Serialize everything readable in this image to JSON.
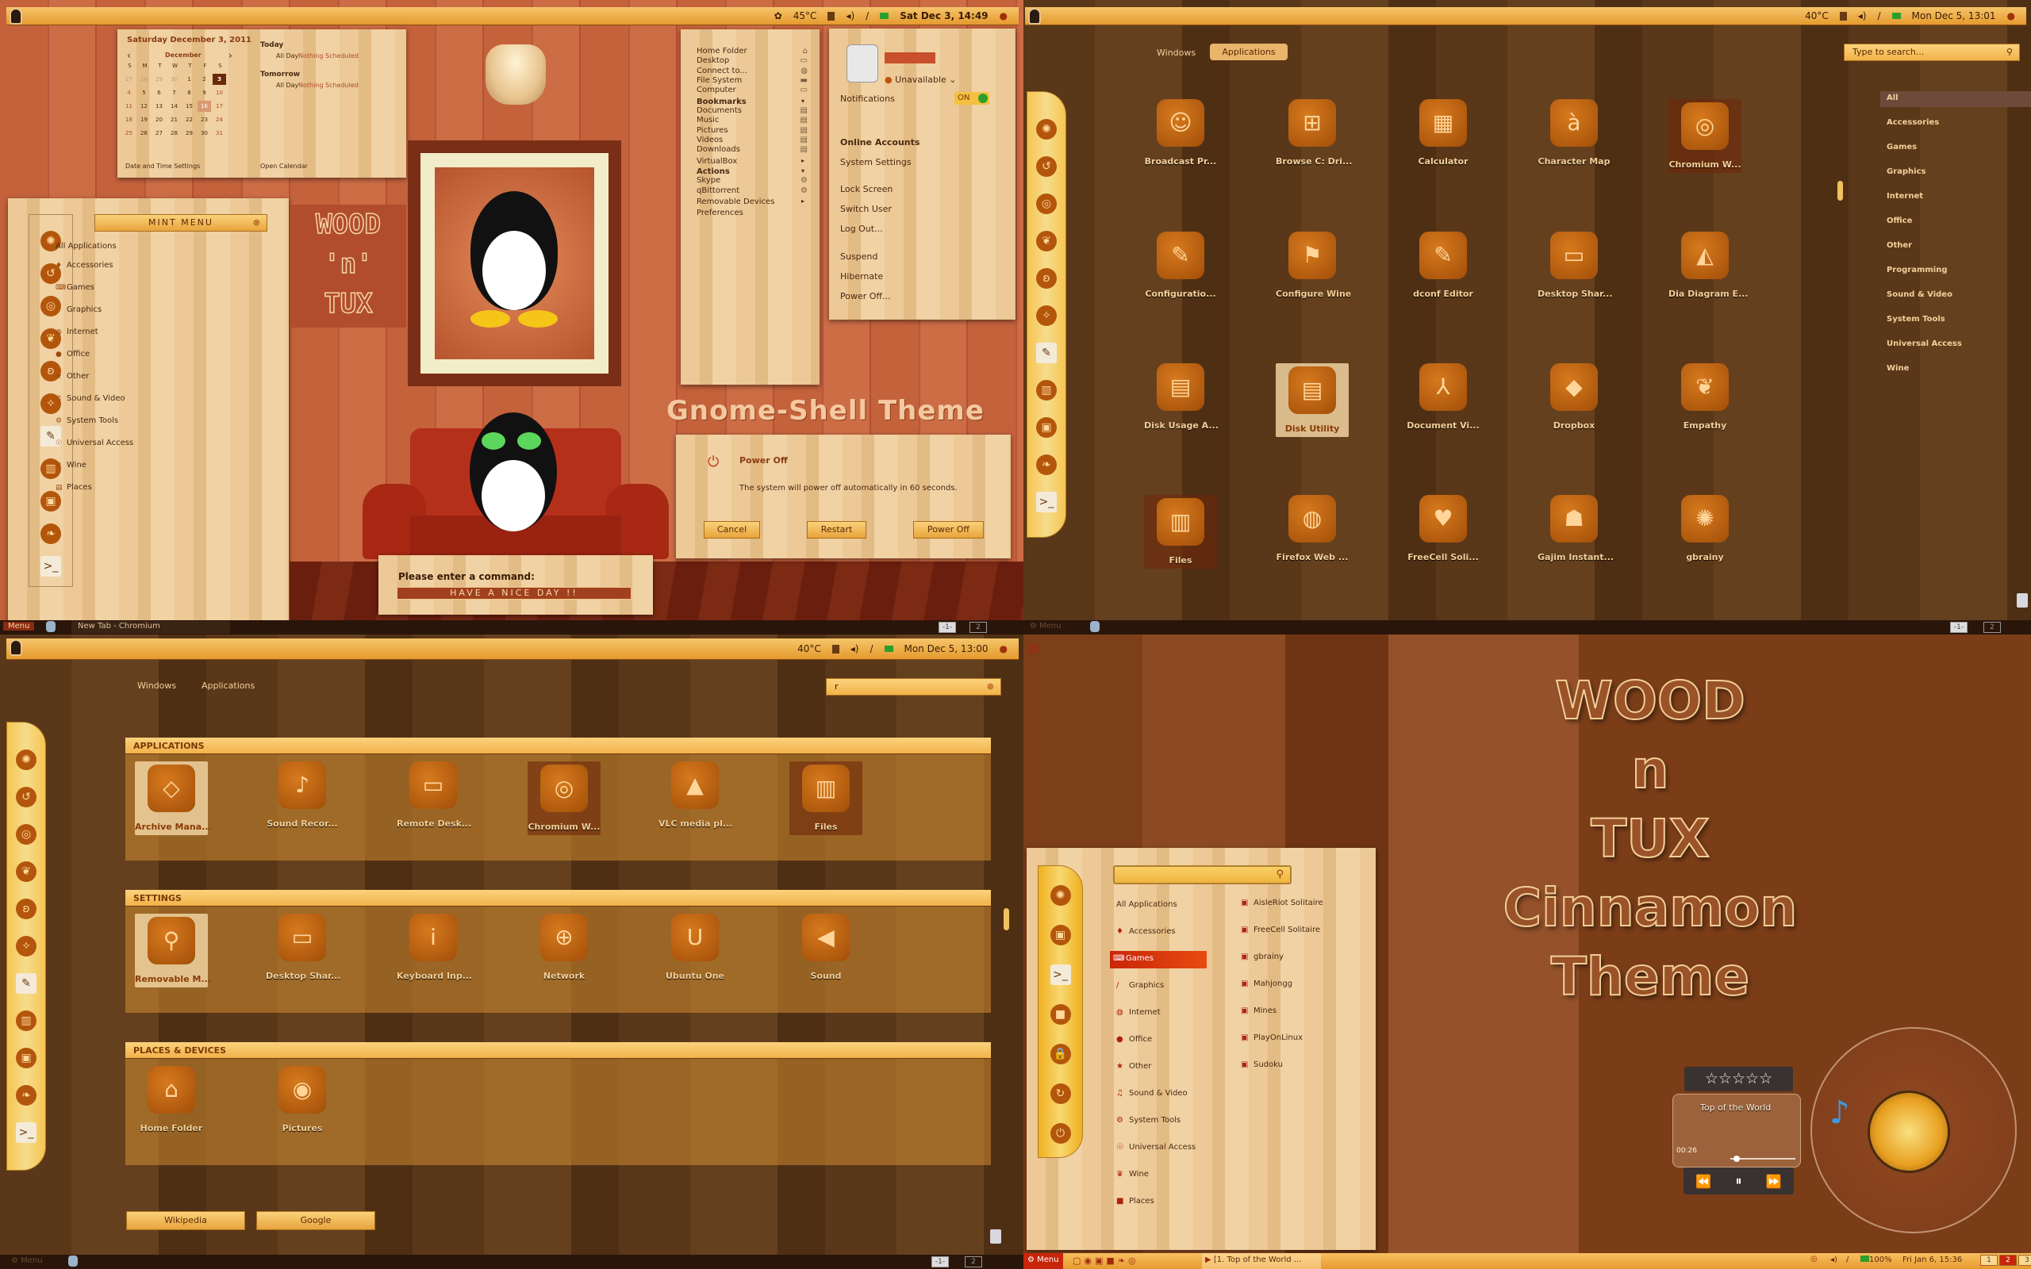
{
  "q1": {
    "top_panel": {
      "temp": "45°C",
      "clock": "Sat Dec 3, 14:49"
    },
    "calendar": {
      "heading": "Saturday December 3, 2011",
      "month": "December",
      "prev": "‹",
      "next": "›",
      "weekdays": [
        "S",
        "M",
        "T",
        "W",
        "T",
        "F",
        "S"
      ],
      "days": [
        "27",
        "28",
        "29",
        "30",
        "1",
        "2",
        "3",
        "4",
        "5",
        "6",
        "7",
        "8",
        "9",
        "10",
        "11",
        "12",
        "13",
        "14",
        "15",
        "16",
        "17",
        "18",
        "19",
        "20",
        "21",
        "22",
        "23",
        "24",
        "25",
        "26",
        "27",
        "28",
        "29",
        "30",
        "31"
      ],
      "selected_day": "3",
      "hover_day": "16",
      "today_label": "Today",
      "tomorrow_label": "Tomorrow",
      "all_day": "All Day",
      "nothing": "Nothing Scheduled",
      "settings_link": "Date and Time Settings",
      "open_link": "Open Calendar"
    },
    "mint_menu": {
      "title": "MINT MENU",
      "items": [
        "All Applications",
        "Accessories",
        "Games",
        "Graphics",
        "Internet",
        "Office",
        "Other",
        "Sound & Video",
        "System Tools",
        "Universal Access",
        "Wine",
        "Places"
      ]
    },
    "sign": [
      "WOOD",
      "'n'",
      "TUX"
    ],
    "places_menu": {
      "items": [
        {
          "label": "Home Folder",
          "icon": "home-icon"
        },
        {
          "label": "Desktop",
          "icon": "desktop-icon"
        },
        {
          "label": "Connect to...",
          "icon": "globe-icon"
        },
        {
          "label": "File System",
          "icon": "drive-icon"
        },
        {
          "label": "Computer",
          "icon": "computer-icon"
        },
        {
          "label": "Bookmarks",
          "heading": true
        },
        {
          "label": "Documents",
          "icon": "folder-icon"
        },
        {
          "label": "Music",
          "icon": "folder-icon"
        },
        {
          "label": "Pictures",
          "icon": "folder-icon"
        },
        {
          "label": "Videos",
          "icon": "folder-icon"
        },
        {
          "label": "Downloads",
          "icon": "folder-icon"
        },
        {
          "label": "VirtualBox",
          "submenu": true
        },
        {
          "label": "Actions",
          "heading": true
        },
        {
          "label": "Skype",
          "icon": "gear-icon"
        },
        {
          "label": "qBittorrent",
          "icon": "gear-icon"
        },
        {
          "label": "Removable Devices",
          "submenu": true
        },
        {
          "label": "Preferences"
        }
      ]
    },
    "user_menu": {
      "status": "Unavailable",
      "notifications": "Notifications",
      "toggle": "ON",
      "items": [
        "Online Accounts",
        "System Settings",
        "Lock Screen",
        "Switch User",
        "Log Out...",
        "Suspend",
        "Hibernate",
        "Power Off..."
      ]
    },
    "theme_title": "Gnome-Shell Theme",
    "power_dialog": {
      "title": "Power Off",
      "message": "The system will power off automatically in 60 seconds.",
      "buttons": [
        "Cancel",
        "Restart",
        "Power Off"
      ]
    },
    "command_dialog": {
      "label": "Please enter a command:",
      "value": "HAVE A NICE DAY   !!"
    },
    "taskbar": {
      "menu": "Menu",
      "task": "New Tab - Chromium",
      "workspaces": [
        "-1-",
        "2"
      ]
    }
  },
  "q2": {
    "top_panel": {
      "temp": "40°C",
      "clock": "Mon Dec 5, 13:01"
    },
    "tabs": [
      "Windows",
      "Applications"
    ],
    "active_tab": "Applications",
    "search_placeholder": "Type to search...",
    "apps": [
      {
        "label": "Broadcast Pr...",
        "glyph": "☺"
      },
      {
        "label": "Browse C: Dri...",
        "glyph": "⊞"
      },
      {
        "label": "Calculator",
        "glyph": "▦"
      },
      {
        "label": "Character Map",
        "glyph": "à"
      },
      {
        "label": "Chromium W...",
        "glyph": "◎",
        "state": "dark"
      },
      {
        "label": "Configuratio...",
        "glyph": "✎"
      },
      {
        "label": "Configure Wine",
        "glyph": "⚑"
      },
      {
        "label": "dconf Editor",
        "glyph": "✎"
      },
      {
        "label": "Desktop Shar...",
        "glyph": "▭"
      },
      {
        "label": "Dia Diagram E...",
        "glyph": "◭"
      },
      {
        "label": "Disk Usage A...",
        "glyph": "▤"
      },
      {
        "label": "Disk Utility",
        "glyph": "▤",
        "state": "sel"
      },
      {
        "label": "Document Vi...",
        "glyph": "⅄"
      },
      {
        "label": "Dropbox",
        "glyph": "◆"
      },
      {
        "label": "Empathy",
        "glyph": "❦"
      },
      {
        "label": "Files",
        "glyph": "▥",
        "state": "dark"
      },
      {
        "label": "Firefox Web ...",
        "glyph": "◍"
      },
      {
        "label": "FreeCell Soli...",
        "glyph": "♥"
      },
      {
        "label": "Gajim Instant...",
        "glyph": "☗"
      },
      {
        "label": "gbrainy",
        "glyph": "✺"
      }
    ],
    "categories": [
      "All",
      "Accessories",
      "Games",
      "Graphics",
      "Internet",
      "Office",
      "Other",
      "Programming",
      "Sound & Video",
      "System Tools",
      "Universal Access",
      "Wine"
    ],
    "active_category": "All",
    "taskbar": {
      "menu": "Menu",
      "workspaces": [
        "-1-",
        "2"
      ]
    }
  },
  "q3": {
    "top_panel": {
      "temp": "40°C",
      "clock": "Mon Dec 5, 13:00"
    },
    "tabs": [
      "Windows",
      "Applications"
    ],
    "search_value": "r",
    "sections": [
      {
        "title": "APPLICATIONS",
        "items": [
          {
            "label": "Archive Mana...",
            "glyph": "◇",
            "state": "sel"
          },
          {
            "label": "Sound Recor...",
            "glyph": "♪"
          },
          {
            "label": "Remote Desk...",
            "glyph": "▭"
          },
          {
            "label": "Chromium W...",
            "glyph": "◎",
            "state": "dark"
          },
          {
            "label": "VLC media pl...",
            "glyph": "▲"
          },
          {
            "label": "Files",
            "glyph": "▥",
            "state": "dark"
          }
        ]
      },
      {
        "title": "SETTINGS",
        "items": [
          {
            "label": "Removable M...",
            "glyph": "⚲",
            "state": "sel"
          },
          {
            "label": "Desktop Shar...",
            "glyph": "▭"
          },
          {
            "label": "Keyboard Inp...",
            "glyph": "i"
          },
          {
            "label": "Network",
            "glyph": "⊕"
          },
          {
            "label": "Ubuntu One",
            "glyph": "U"
          },
          {
            "label": "Sound",
            "glyph": "◀"
          }
        ]
      },
      {
        "title": "PLACES & DEVICES",
        "items": [
          {
            "label": "Home Folder",
            "glyph": "⌂"
          },
          {
            "label": "Pictures",
            "glyph": "◉"
          }
        ]
      }
    ],
    "search_buttons": [
      "Wikipedia",
      "Google"
    ],
    "taskbar": {
      "menu": "Menu",
      "workspaces": [
        "-1-",
        "2"
      ]
    }
  },
  "q4": {
    "title_lines": [
      "WOOD",
      "n",
      "TUX",
      "Cinnamon",
      "Theme"
    ],
    "menu": {
      "categories": [
        "All Applications",
        "Accessories",
        "Games",
        "Graphics",
        "Internet",
        "Office",
        "Other",
        "Sound & Video",
        "System Tools",
        "Universal Access",
        "Wine",
        "Places"
      ],
      "active_category": "Games",
      "apps": [
        "AisleRiot Solitaire",
        "FreeCell Solitaire",
        "gbrainy",
        "Mahjongg",
        "Mines",
        "PlayOnLinux",
        "Sudoku"
      ]
    },
    "player": {
      "rating": 0,
      "rating_max": 5,
      "track": "Top of the World",
      "elapsed": "00:26",
      "progress": 0.1
    },
    "taskbar": {
      "menu": "Menu",
      "task": "[1. Top of the World ...",
      "battery": "100%",
      "clock": "Fri Jan 6, 15:36",
      "workspaces": [
        "1",
        "2",
        "3"
      ],
      "active_workspace": "2"
    }
  },
  "colors": {
    "accent": "#f2b24a",
    "panel_wood": "#ecc996",
    "dark_wood": "#5a3718",
    "text_brown": "#4a2a12",
    "cinnamon_red": "#c8260a"
  }
}
